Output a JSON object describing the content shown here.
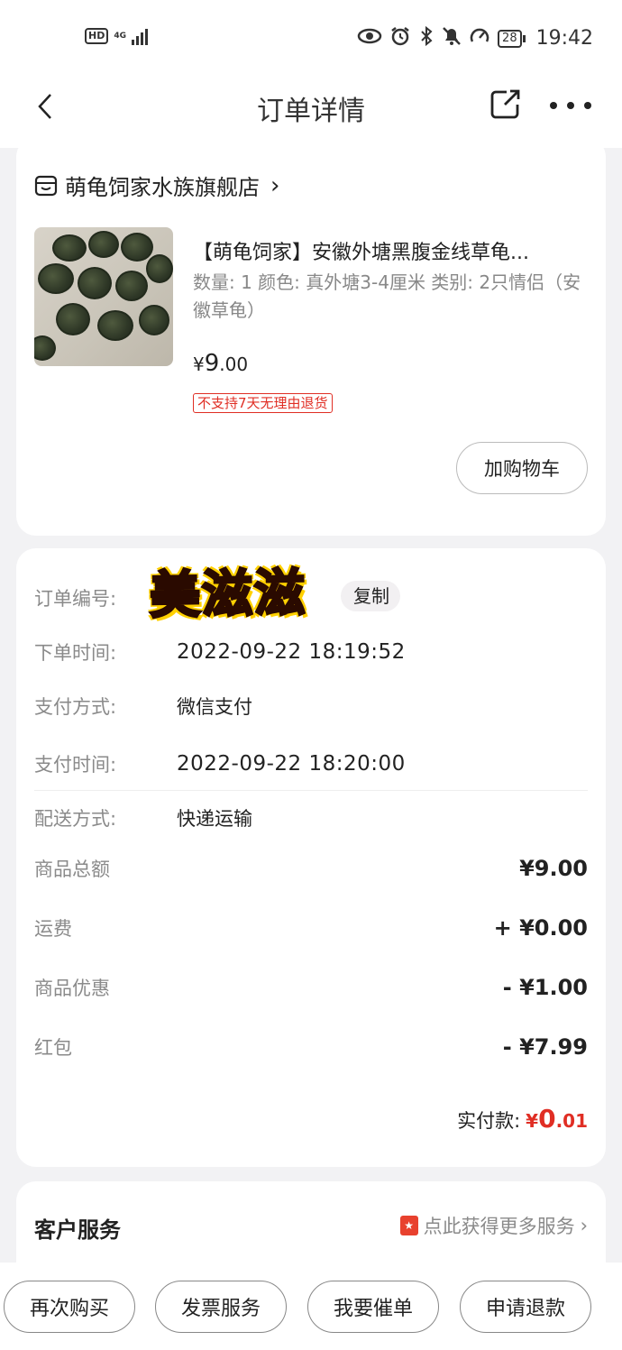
{
  "status_bar": {
    "hd": "HD",
    "network": "4G",
    "battery": "28",
    "time": "19:42"
  },
  "header": {
    "title": "订单详情"
  },
  "shop": {
    "name": "萌龟饲家水族旗舰店",
    "chevron": "›"
  },
  "product": {
    "title": "【萌龟饲家】安徽外塘黑腹金线草龟...",
    "specs": "数量: 1  颜色: 真外塘3-4厘米  类别: 2只情侣（安徽草龟）",
    "price_symbol": "¥",
    "price_int": "9",
    "price_dec": ".00",
    "badge": "不支持7天无理由退货",
    "add_cart": "加购物车"
  },
  "order_info": {
    "order_no_label": "订单编号:",
    "sticker_text": "美滋滋",
    "copy": "复制",
    "order_time_label": "下单时间:",
    "order_time": "2022-09-22 18:19:52",
    "pay_method_label": "支付方式:",
    "pay_method": "微信支付",
    "pay_time_label": "支付时间:",
    "pay_time": "2022-09-22 18:20:00",
    "delivery_label": "配送方式:",
    "delivery": "快递运输"
  },
  "amounts": {
    "goods_total_label": "商品总额",
    "goods_total": "¥9.00",
    "shipping_label": "运费",
    "shipping": "+ ¥0.00",
    "discount_label": "商品优惠",
    "discount": "- ¥1.00",
    "red_packet_label": "红包",
    "red_packet": "- ¥7.99",
    "paid_label": "实付款:",
    "paid_symbol": "¥",
    "paid_int": "0",
    "paid_dec": ".01"
  },
  "service": {
    "title": "客户服务",
    "link": "点此获得更多服务",
    "chevron": "›"
  },
  "bottom": {
    "rebuy": "再次购买",
    "invoice": "发票服务",
    "urge": "我要催单",
    "refund": "申请退款"
  },
  "colors": {
    "accent_red": "#e02e24",
    "background": "#f2f2f4"
  }
}
